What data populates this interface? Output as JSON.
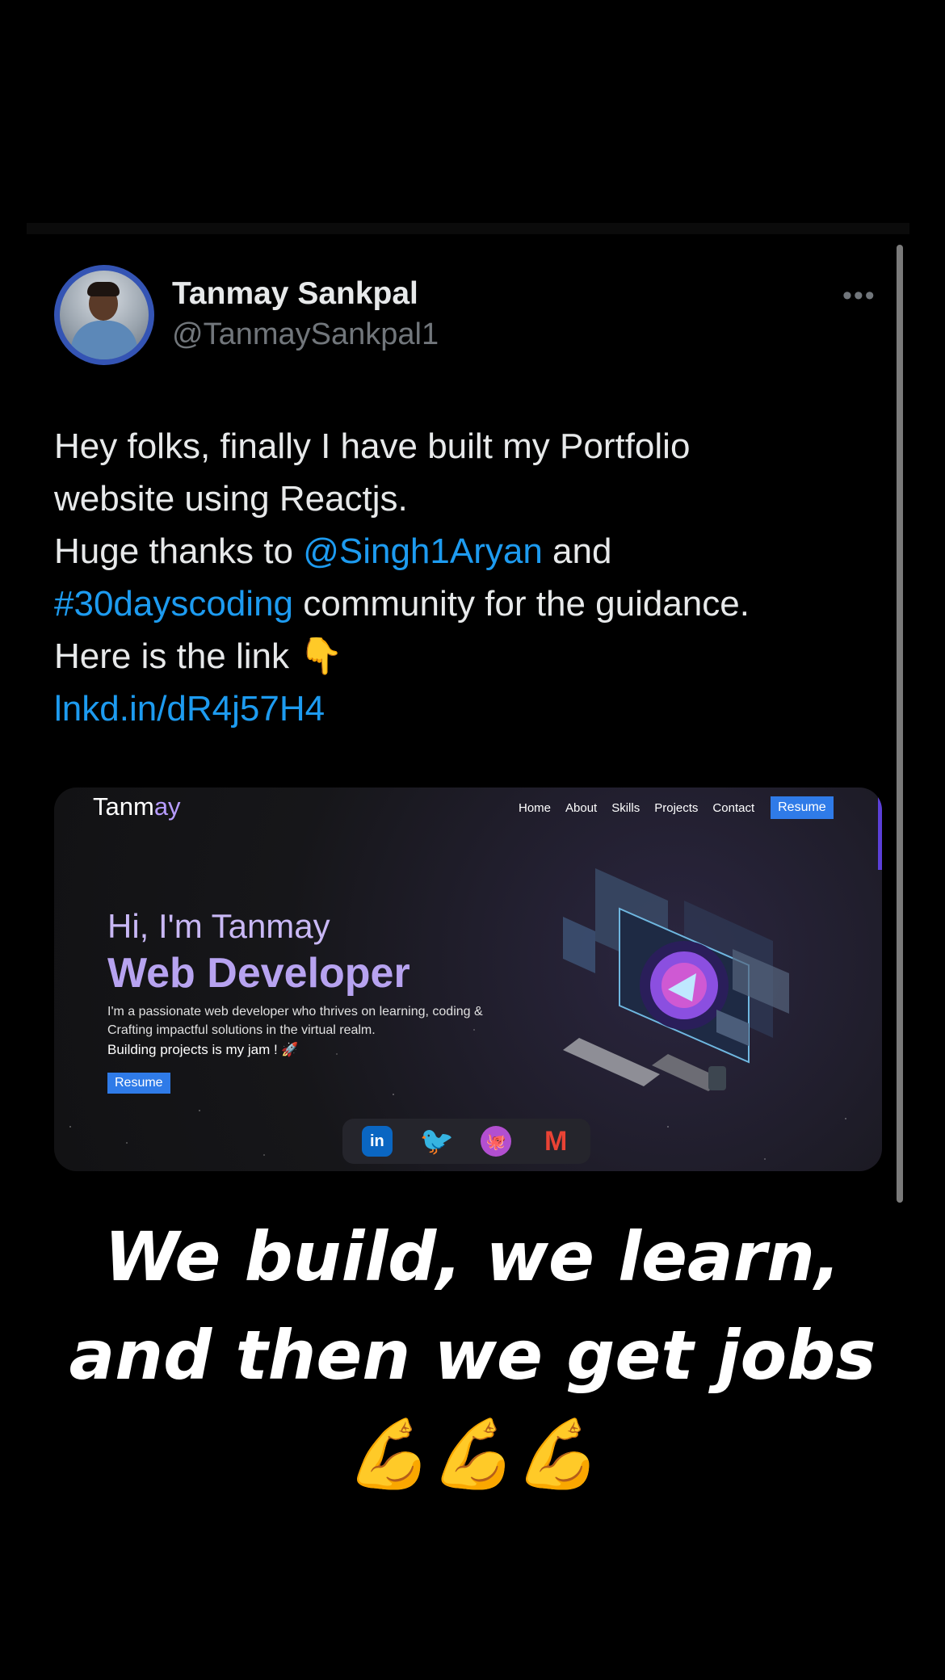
{
  "tweet": {
    "author_name": "Tanmay Sankpal",
    "author_handle": "@TanmaySankpal1",
    "more_icon": "more-icon",
    "text_line1": "Hey folks, finally I have built my Portfolio",
    "text_line2": "website using Reactjs.",
    "text_line3_before": "Huge thanks to ",
    "mention": "@Singh1Aryan",
    "text_line3_after": " and",
    "hashtag": "#30dayscoding",
    "text_line4_after": " community for the guidance.",
    "text_line5": "Here is the link ",
    "pointing_emoji": "👇",
    "link": "lnkd.in/dR4j57H4",
    "link_color": "#1d9bf0"
  },
  "preview": {
    "logo_prefix": "Tanm",
    "logo_suffix": "ay",
    "nav": [
      "Home",
      "About",
      "Skills",
      "Projects",
      "Contact"
    ],
    "nav_resume": "Resume",
    "hero_greeting": "Hi, I'm Tanmay",
    "hero_title": "Web Developer",
    "hero_desc": "I'm a passionate web developer who thrives on learning, coding & Crafting impactful solutions in the virtual realm.",
    "hero_jam": "Building projects is my jam ! 🚀",
    "hero_resume": "Resume",
    "socials": [
      "linkedin-icon",
      "twitter-icon",
      "github-icon",
      "gmail-icon"
    ],
    "accent_color": "#2f7be8"
  },
  "caption": {
    "line1": "We build, we learn,",
    "line2": "and then we get jobs",
    "line3": "💪💪💪"
  }
}
